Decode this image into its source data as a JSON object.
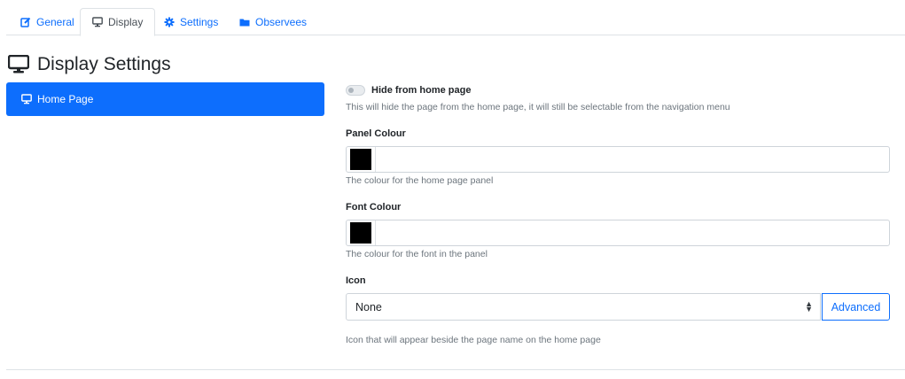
{
  "tabs": [
    {
      "label": "General",
      "icon": "edit-icon",
      "active": false
    },
    {
      "label": "Display",
      "icon": "monitor-icon",
      "active": true
    },
    {
      "label": "Settings",
      "icon": "gear-icon",
      "active": false
    },
    {
      "label": "Observees",
      "icon": "folder-icon",
      "active": false
    }
  ],
  "page": {
    "title": "Display Settings",
    "icon": "monitor-icon"
  },
  "sidebar": {
    "items": [
      {
        "label": "Home Page",
        "icon": "monitor-icon",
        "active": true
      }
    ]
  },
  "form": {
    "hide_label": "Hide from home page",
    "hide_enabled": false,
    "hide_help": "This will hide the page from the home page, it will still be selectable from the navigation menu",
    "panel_colour_label": "Panel Colour",
    "panel_colour_value": "#000000",
    "panel_colour_help": "The colour for the home page panel",
    "font_colour_label": "Font Colour",
    "font_colour_value": "#000000",
    "font_colour_help": "The colour for the font in the panel",
    "icon_label": "Icon",
    "icon_selected": "None",
    "advanced_label": "Advanced",
    "icon_help": "Icon that will appear beside the page name on the home page"
  },
  "colors": {
    "accent": "#0d6efd",
    "muted": "#6c757d",
    "border": "#dee2e6"
  }
}
